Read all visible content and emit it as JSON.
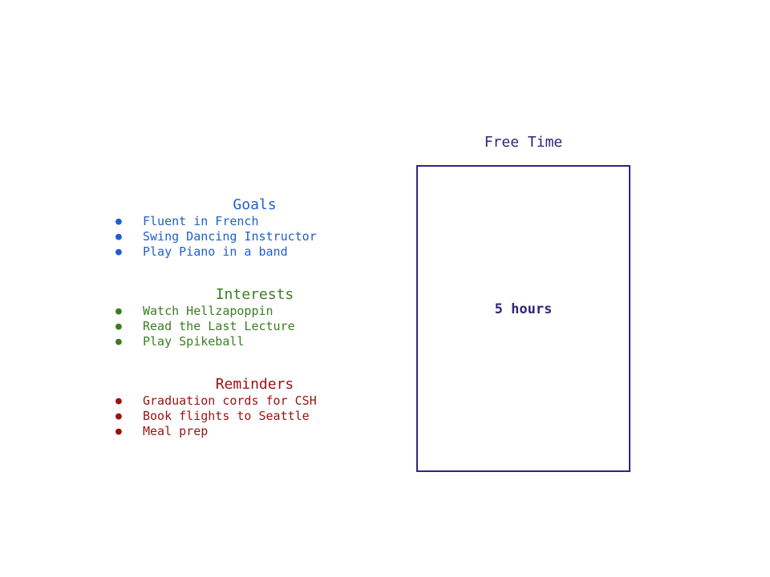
{
  "colors": {
    "goals": "#1f5fcc",
    "interests": "#3b7d23",
    "reminders": "#9b1111",
    "free_time": "#33237a"
  },
  "bullet_glyph": "●",
  "goals": {
    "title": "Goals",
    "items": [
      {
        "label": "Fluent in French"
      },
      {
        "label": "Swing Dancing Instructor"
      },
      {
        "label": "Play Piano in a band"
      }
    ]
  },
  "interests": {
    "title": "Interests",
    "items": [
      {
        "label": "Watch Hellzapoppin"
      },
      {
        "label": "Read the Last Lecture"
      },
      {
        "label": "Play Spikeball"
      }
    ]
  },
  "reminders": {
    "title": "Reminders",
    "items": [
      {
        "label": "Graduation cords for CSH"
      },
      {
        "label": "Book flights to Seattle"
      },
      {
        "label": "Meal prep"
      }
    ]
  },
  "free_time": {
    "title": "Free Time",
    "value": "5 hours"
  }
}
